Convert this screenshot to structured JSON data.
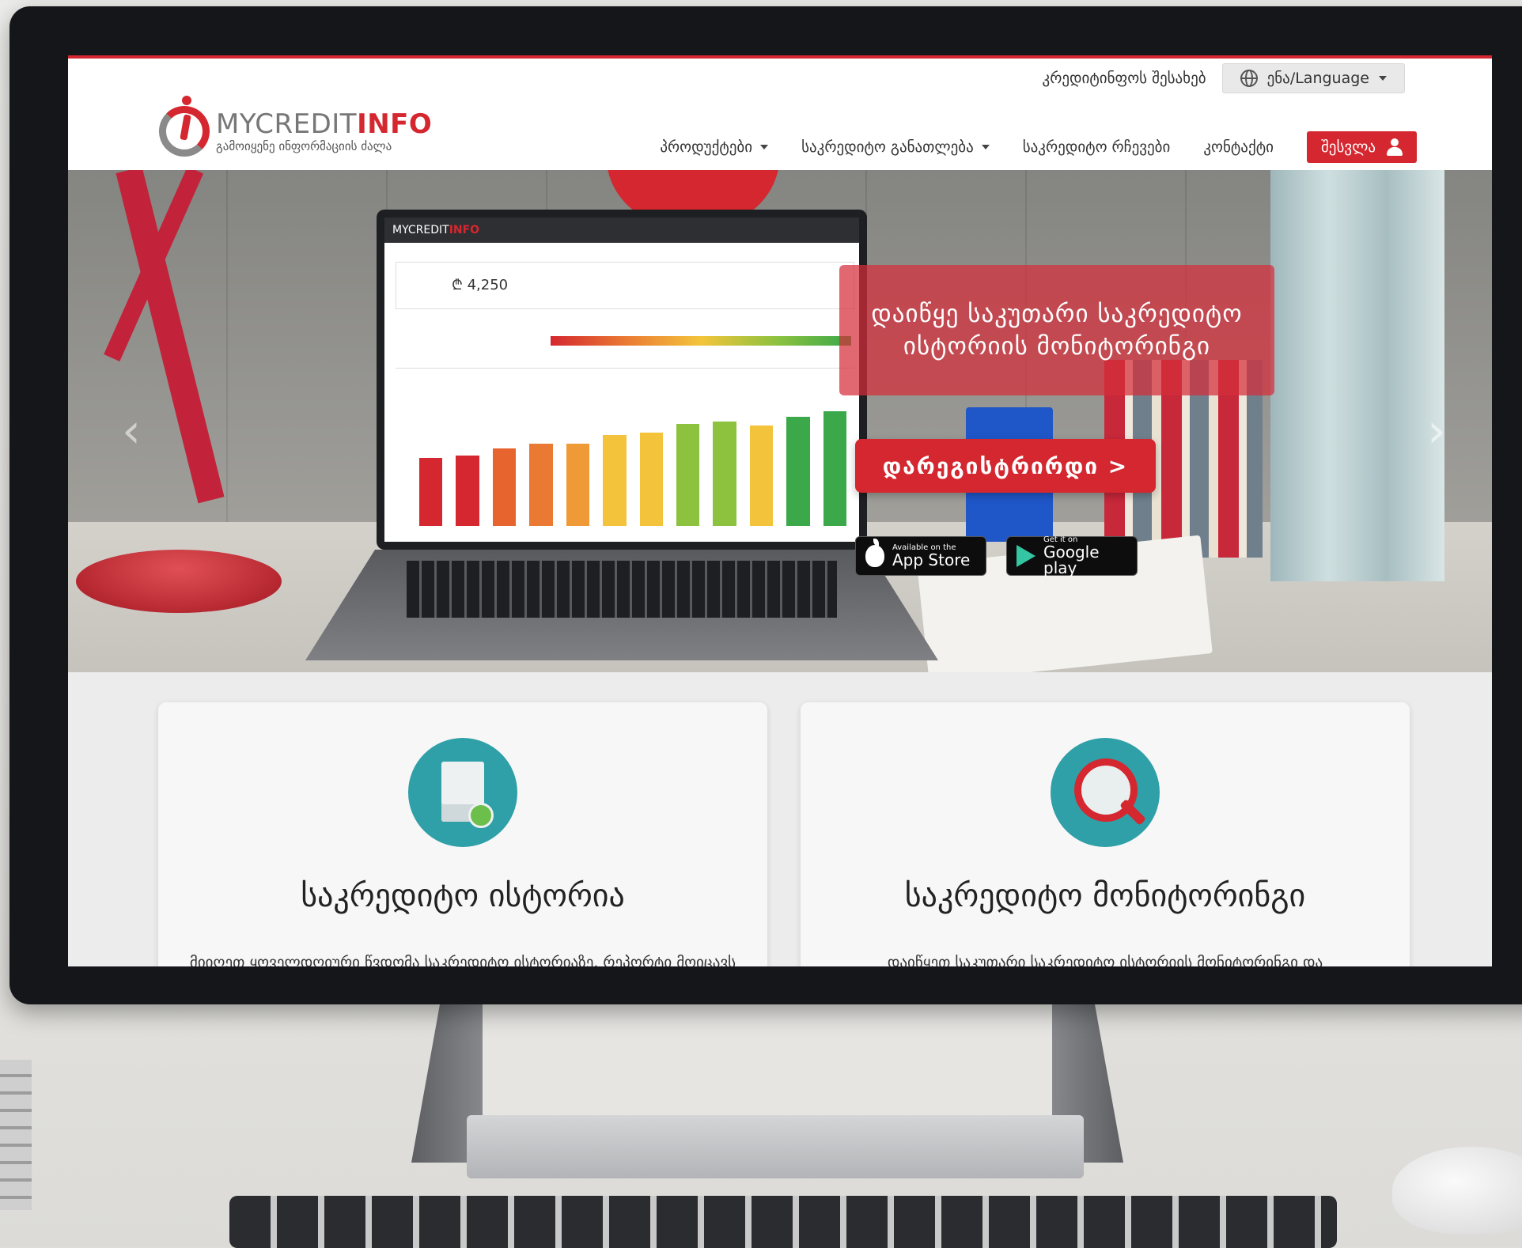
{
  "header": {
    "about_link": "კრედიტინფოს შესახებ",
    "language_label": "ენა/Language",
    "logo": {
      "name_part1": "MYCREDIT",
      "name_part2": "INFO",
      "tagline": "გამოიყენე ინფორმაციის ძალა"
    },
    "nav": [
      {
        "label": "პროდუქტები",
        "has_dropdown": true
      },
      {
        "label": "საკრედიტო განათლება",
        "has_dropdown": true
      },
      {
        "label": "საკრედიტო რჩევები",
        "has_dropdown": false
      },
      {
        "label": "კონტაქტი",
        "has_dropdown": false
      }
    ],
    "login_label": "შესვლა"
  },
  "hero": {
    "banner_line1": "დაიწყე საკუთარი საკრედიტო",
    "banner_line2": "ისტორიის მონიტორინგი",
    "register_label": "დარეგისტრირდი >",
    "laptop": {
      "logo_part1": "MYCREDIT",
      "logo_part2": "INFO",
      "score_value": "₾ 4,250",
      "bar_colors": [
        "#d4272f",
        "#d4272f",
        "#e8642f",
        "#ea7a33",
        "#ef9a36",
        "#f3c43b",
        "#f3c43b",
        "#8dc23f",
        "#8dc23f",
        "#f3c43b",
        "#3ba84a",
        "#3ba84a"
      ],
      "bar_levels": [
        0.48,
        0.5,
        0.55,
        0.58,
        0.58,
        0.64,
        0.66,
        0.72,
        0.74,
        0.71,
        0.77,
        0.81
      ]
    },
    "app_store": {
      "small": "Available on the",
      "big": "App Store"
    },
    "google_play": {
      "small": "Get it on",
      "big": "Google play"
    }
  },
  "cards": [
    {
      "icon": "document-check-icon",
      "title": "საკრედიტო ისტორია",
      "text": "მიიღეთ ყოველდღიური წვდომა საკრედიტო ისტორიაზე. რეპორტი მოიცავს"
    },
    {
      "icon": "search-person-icon",
      "title": "საკრედიტო მონიტორინგი",
      "text": "დაიწყეთ საკუთარი საკრედიტო ისტორიის მონიტორინგი და"
    }
  ],
  "colors": {
    "brand_red": "#d4272f",
    "accent_teal": "#2fa0a8"
  }
}
